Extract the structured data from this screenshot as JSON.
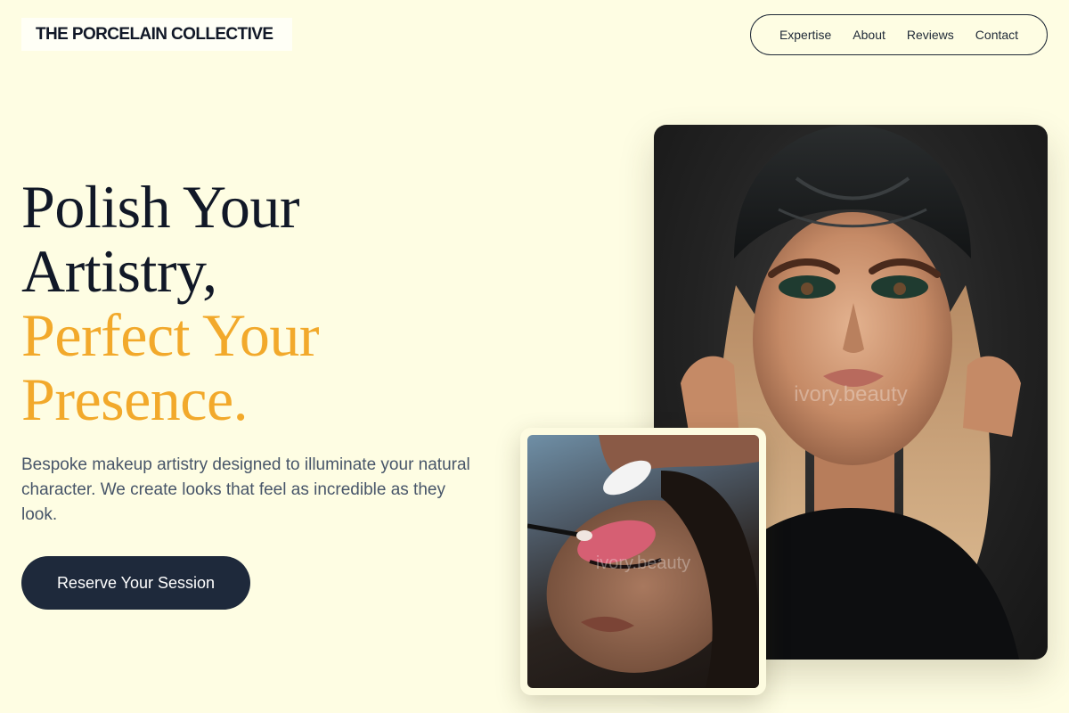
{
  "brand": {
    "name": "THE PORCELAIN COLLECTIVE"
  },
  "nav": {
    "items": [
      "Expertise",
      "About",
      "Reviews",
      "Contact"
    ]
  },
  "hero": {
    "headline_line1": "Polish Your",
    "headline_line2": "Artistry,",
    "headline_accent1": "Perfect Your",
    "headline_accent2": "Presence.",
    "lead": "Bespoke makeup artistry designed to illuminate your natural character. We create looks that feel as incredible as they look.",
    "cta_label": "Reserve Your Session"
  },
  "images": {
    "main_watermark": "ivory.beauty",
    "secondary_watermark": "ivory.beauty"
  },
  "colors": {
    "background": "#fefde3",
    "accent": "#f2a92b",
    "dark": "#1e293b",
    "body_text": "#475569"
  }
}
